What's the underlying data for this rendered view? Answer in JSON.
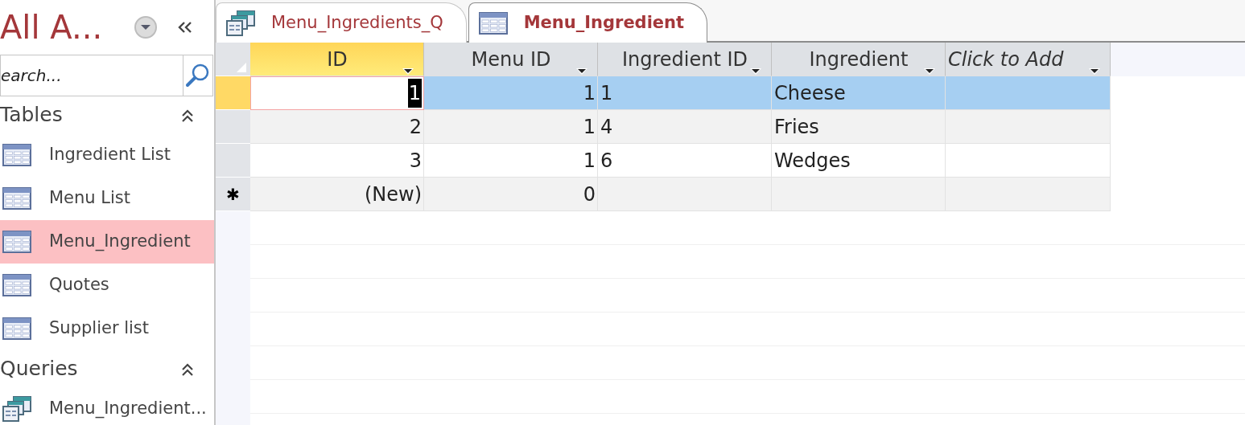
{
  "navigation_pane": {
    "title": "All A...",
    "search": {
      "placeholder": "earch..."
    },
    "groups": [
      {
        "label": "Tables",
        "expanded": true,
        "items": [
          {
            "label": "Ingredient List",
            "kind": "table",
            "selected": false
          },
          {
            "label": "Menu List",
            "kind": "table",
            "selected": false
          },
          {
            "label": "Menu_Ingredient",
            "kind": "table",
            "selected": true
          },
          {
            "label": "Quotes",
            "kind": "table",
            "selected": false
          },
          {
            "label": "Supplier list",
            "kind": "table",
            "selected": false
          }
        ]
      },
      {
        "label": "Queries",
        "expanded": true,
        "items": [
          {
            "label": "Menu_Ingredient...",
            "kind": "query",
            "selected": false
          }
        ]
      }
    ]
  },
  "tabs": [
    {
      "label": "Menu_Ingredients_Q",
      "kind": "query",
      "selected": false
    },
    {
      "label": "Menu_Ingredient",
      "kind": "table",
      "selected": true
    }
  ],
  "table": {
    "columns": [
      {
        "label": "ID",
        "kind": "number",
        "selected": true
      },
      {
        "label": "Menu ID",
        "kind": "number",
        "selected": false
      },
      {
        "label": "Ingredient ID",
        "kind": "lookup",
        "selected": false
      },
      {
        "label": "Ingredient",
        "kind": "text",
        "selected": false
      },
      {
        "label": "Click to Add",
        "kind": "add",
        "selected": false
      }
    ],
    "rows": [
      {
        "kind": "record",
        "selected": true,
        "cells": [
          "1",
          "1",
          "1",
          "Cheese",
          ""
        ]
      },
      {
        "kind": "record",
        "selected": false,
        "cells": [
          "2",
          "1",
          "4",
          "Fries",
          ""
        ]
      },
      {
        "kind": "record",
        "selected": false,
        "cells": [
          "3",
          "1",
          "6",
          "Wedges",
          ""
        ]
      },
      {
        "kind": "new",
        "selected": false,
        "marker": "✱",
        "cells": [
          "(New)",
          "0",
          "",
          "",
          ""
        ]
      }
    ]
  }
}
